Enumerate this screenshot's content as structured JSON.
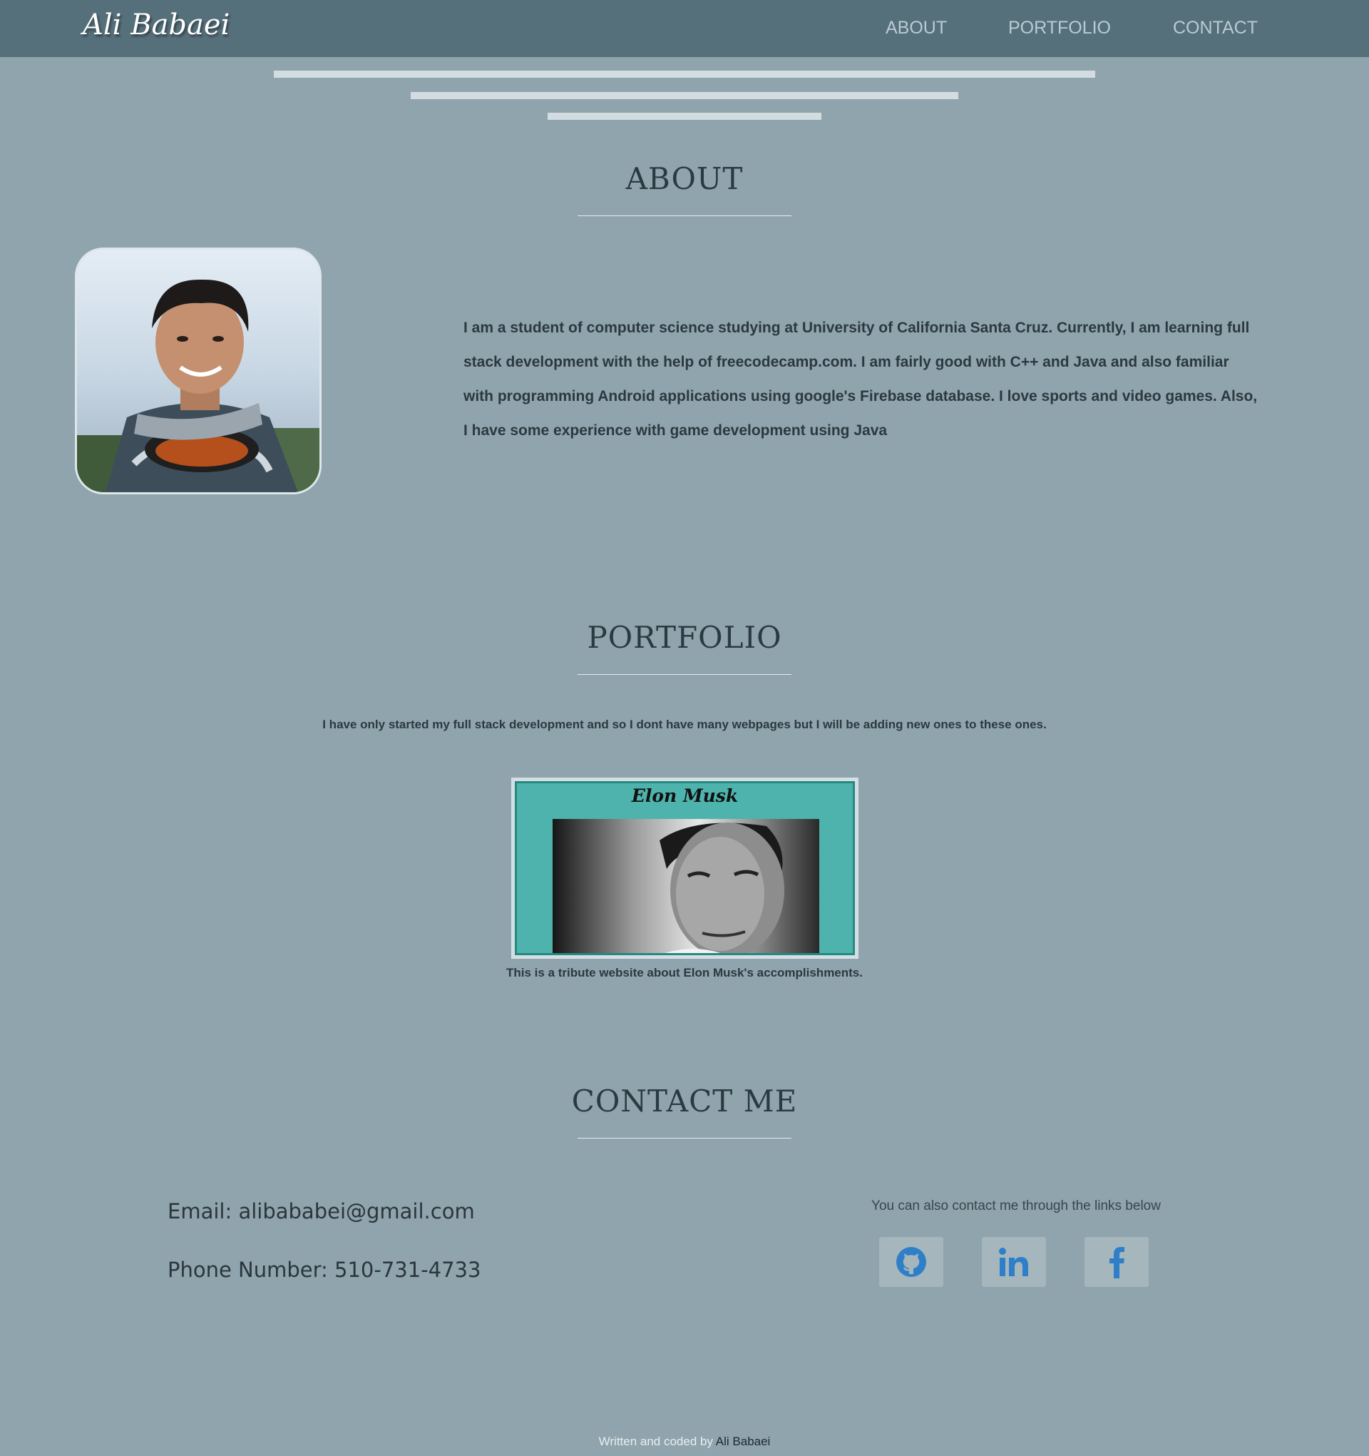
{
  "nav": {
    "brand": "Ali Babaei",
    "links": [
      "ABOUT",
      "PORTFOLIO",
      "CONTACT"
    ]
  },
  "about": {
    "title": "ABOUT",
    "text": "I am a student of computer science studying at University of California Santa Cruz. Currently, I am learning full stack development with the help of freecodecamp.com. I am fairly good with C++ and Java and also familiar with programming Android applications using google's Firebase database. I love sports and video games. Also, I have some experience with game development using Java"
  },
  "portfolio": {
    "title": "PORTFOLIO",
    "intro": "I have only started my full stack development and so I dont have many webpages but I will be adding new ones to these ones.",
    "project": {
      "heading": "Elon Musk",
      "caption": "This is a tribute website about Elon Musk's accomplishments."
    }
  },
  "contact": {
    "title": "CONTACT ME",
    "email": "Email: alibababei@gmail.com",
    "phone": "Phone Number: 510-731-4733",
    "links_note": "You can also contact me through the links below",
    "social": [
      {
        "icon": "github-icon"
      },
      {
        "icon": "linkedin-icon"
      },
      {
        "icon": "facebook-icon"
      }
    ]
  },
  "footer": {
    "prefix": "Written and coded by",
    "name": "Ali Babaei"
  },
  "colors": {
    "background": "#8fa4ad",
    "navbar": "#56707b",
    "accent_blue": "#2f7fc8",
    "project_teal": "#4db3ac"
  }
}
